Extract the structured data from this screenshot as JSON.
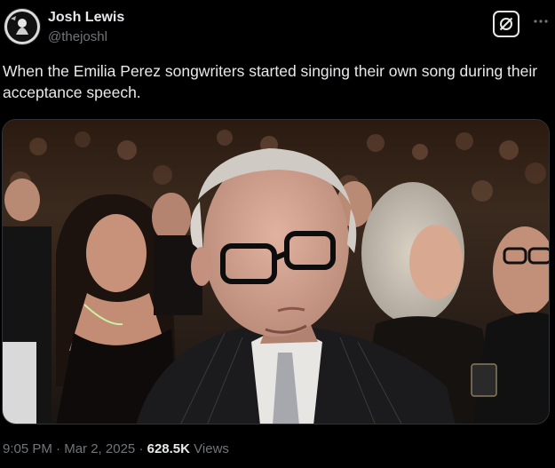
{
  "author": {
    "name": "Josh Lewis",
    "handle": "@thejoshl"
  },
  "icons": {
    "grok": "grok-icon",
    "more": "more-options-icon"
  },
  "tweet": {
    "text": "When the Emilia Perez songwriters started singing their own song during their acceptance speech."
  },
  "meta": {
    "time": "9:05 PM",
    "separator": "·",
    "date": "Mar 2, 2025",
    "views_count": "628.5K",
    "views_label": "Views"
  },
  "colors": {
    "background": "#000000",
    "text_primary": "#e7e9ea",
    "text_secondary": "#71767b",
    "border": "#2f3336"
  }
}
